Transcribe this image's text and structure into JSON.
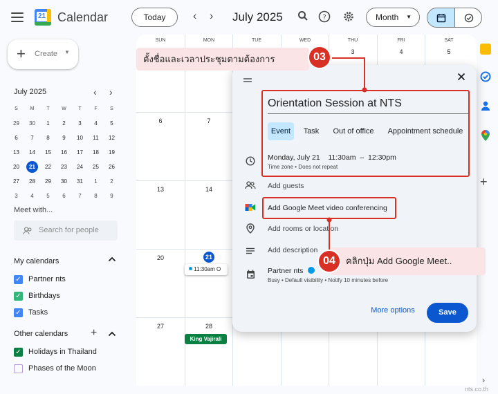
{
  "header": {
    "app_title": "Calendar",
    "logo_day": "21",
    "today_label": "Today",
    "month_title": "July 2025",
    "view_label": "Month"
  },
  "sidebar": {
    "create_label": "Create",
    "mini_title": "July 2025",
    "weekdays": [
      "S",
      "M",
      "T",
      "W",
      "T",
      "F",
      "S"
    ],
    "weeks": [
      [
        "29",
        "30",
        "1",
        "2",
        "3",
        "4",
        "5"
      ],
      [
        "6",
        "7",
        "8",
        "9",
        "10",
        "11",
        "12"
      ],
      [
        "13",
        "14",
        "15",
        "16",
        "17",
        "18",
        "19"
      ],
      [
        "20",
        "21",
        "22",
        "23",
        "24",
        "25",
        "26"
      ],
      [
        "27",
        "28",
        "29",
        "30",
        "31",
        "1",
        "2"
      ],
      [
        "3",
        "4",
        "5",
        "6",
        "7",
        "8",
        "9"
      ]
    ],
    "meet_with": "Meet with...",
    "search_people_placeholder": "Search for people",
    "my_calendars_title": "My calendars",
    "my_calendars": [
      {
        "label": "Partner nts",
        "color": "#4285f4"
      },
      {
        "label": "Birthdays",
        "color": "#33b679"
      },
      {
        "label": "Tasks",
        "color": "#4285f4"
      }
    ],
    "other_calendars_title": "Other calendars",
    "other_calendars": [
      {
        "label": "Holidays in Thailand",
        "color": "#0b8043",
        "checked": true
      },
      {
        "label": "Phases of the Moon",
        "color": "#b39ddb",
        "checked": false
      }
    ]
  },
  "grid": {
    "weekday_headers": [
      "SUN",
      "MON",
      "TUE",
      "WED",
      "THU",
      "FRI",
      "SAT"
    ],
    "week1_visible": [
      "3",
      "4",
      "5"
    ],
    "rows": [
      [
        "6",
        "7"
      ],
      [
        "13",
        "14"
      ],
      [
        "20",
        "21"
      ],
      [
        "27",
        "28"
      ]
    ],
    "event_chip": "11:30am O",
    "holiday_chip": "King Vajirali"
  },
  "popup": {
    "title": "Orientation Session at NTS",
    "tabs": [
      "Event",
      "Task",
      "Out of office",
      "Appointment schedule"
    ],
    "date": "Monday, July 21",
    "time_start": "11:30am",
    "time_sep": "–",
    "time_end": "12:30pm",
    "timezone_note": "Time zone • Does not repeat",
    "add_guests": "Add guests",
    "add_meet": "Add Google Meet video conferencing",
    "add_rooms": "Add rooms or location",
    "add_description": "Add description",
    "calendar_name": "Partner nts",
    "calendar_details": "Busy • Default visibility • Notify 10 minutes before",
    "more_options": "More options",
    "save": "Save"
  },
  "annotations": {
    "step3_badge": "03",
    "step3_text": "ตั้งชื่อและเวลาประชุมตามต้องการ",
    "step4_badge": "04",
    "step4_text": "คลิกปุ่ม Add Google Meet.."
  },
  "watermark": "nts.co.th",
  "colors": {
    "accent": "#0b57d0",
    "highlight": "#d93025",
    "callout_bg": "#fbe4e6",
    "holiday": "#0b8043"
  }
}
